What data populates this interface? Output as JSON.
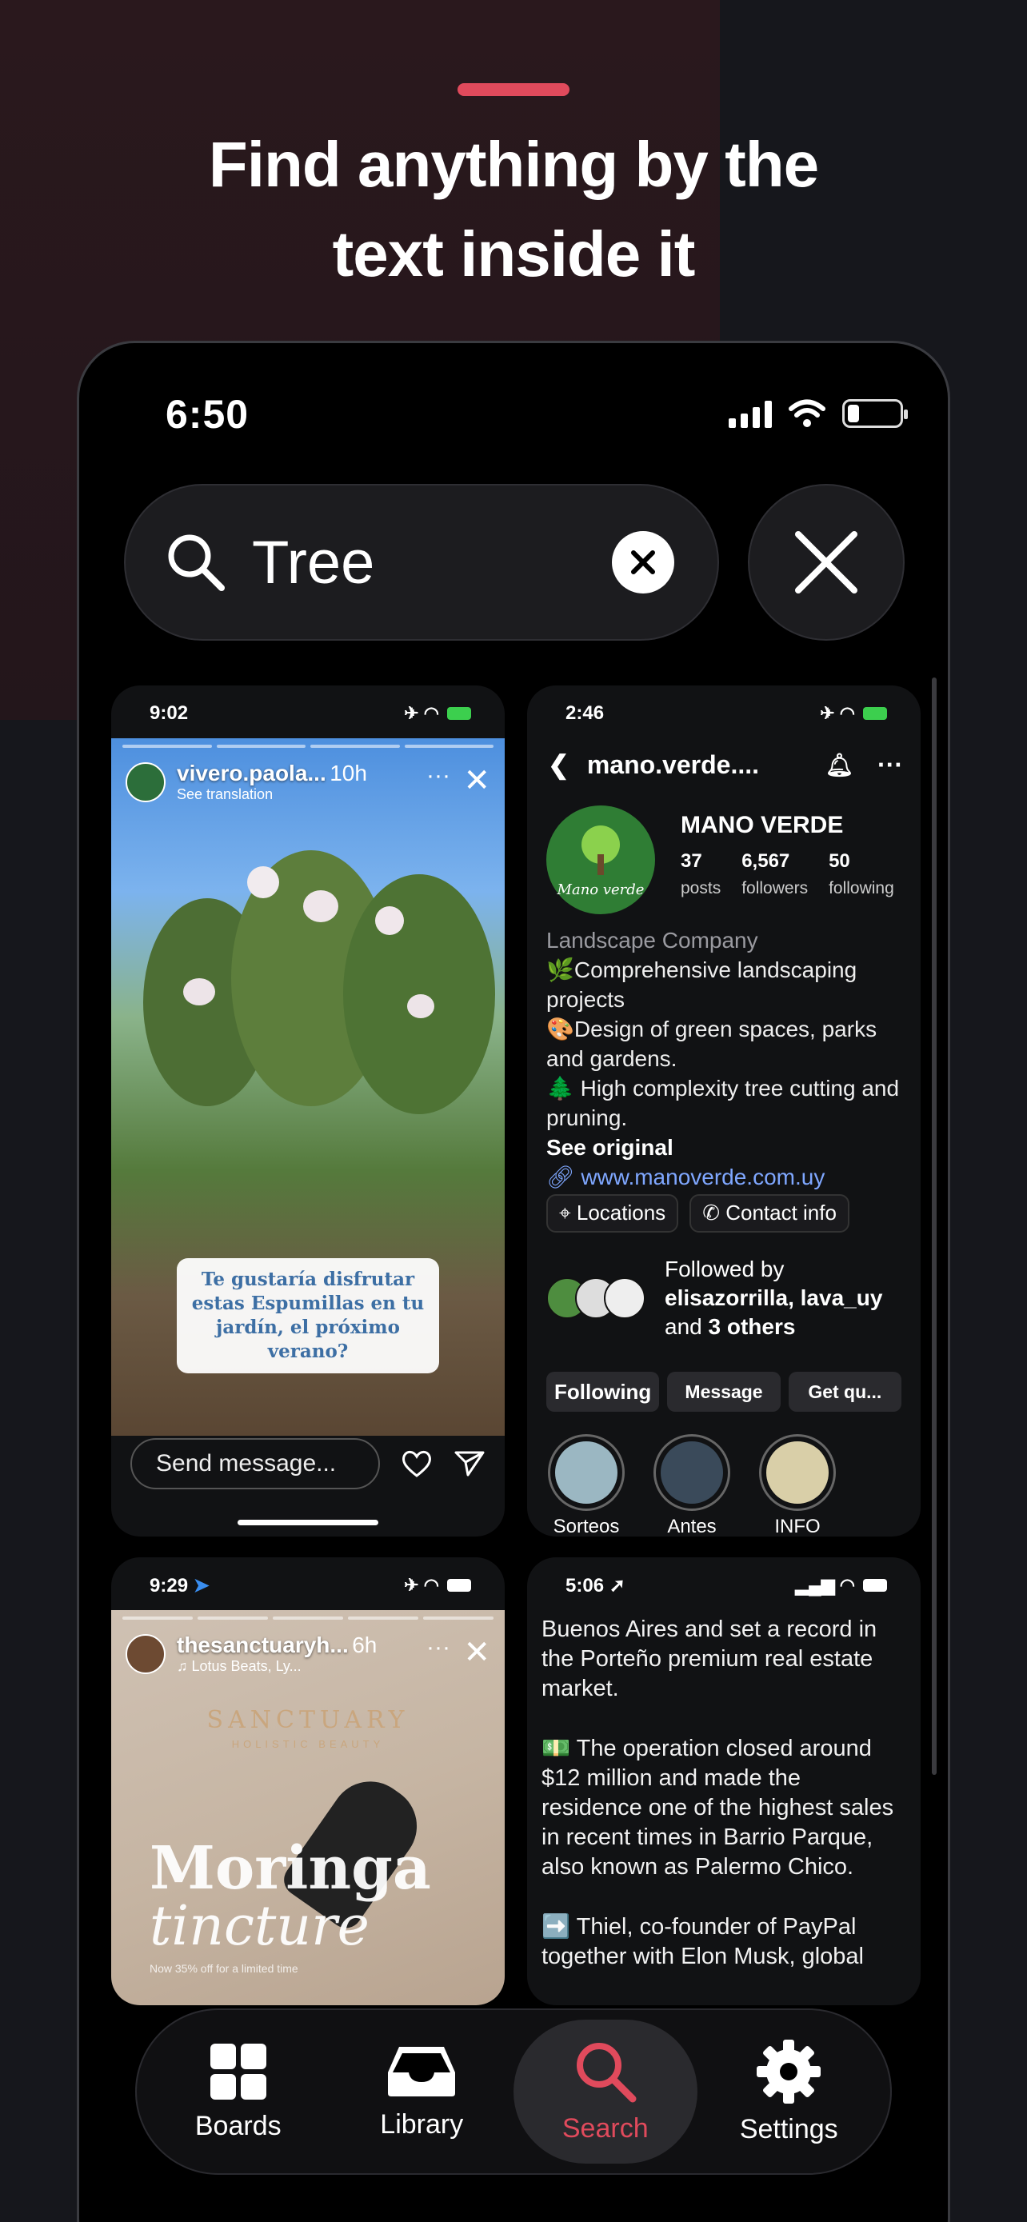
{
  "headline": {
    "line1": "Find anything by the",
    "line2": "text inside it"
  },
  "status_bar": {
    "time": "6:50"
  },
  "search": {
    "query": "Tree"
  },
  "cards": {
    "story1": {
      "time": "9:02",
      "username": "vivero.paola...",
      "subtitle": "See translation",
      "age": "10h",
      "caption": "Te gustaría disfrutar estas Espumillas en tu jardín, el próximo verano?",
      "send_placeholder": "Send message..."
    },
    "profile": {
      "time": "2:46",
      "handle": "mano.verde....",
      "brand": "MANO VERDE",
      "logo_text": "Mano verde",
      "stats": [
        {
          "num": "37",
          "label": "posts"
        },
        {
          "num": "6,567",
          "label": "followers"
        },
        {
          "num": "50",
          "label": "following"
        }
      ],
      "category": "Landscape Company",
      "bio_lines": [
        "🌿Comprehensive landscaping projects",
        "🎨Design of green spaces, parks and gardens.",
        "🌲 High complexity tree cutting and pruning."
      ],
      "see_original": "See original",
      "link": "www.manoverde.com.uy",
      "chips": [
        "Locations",
        "Contact info"
      ],
      "followed_by": "Followed by",
      "followers_names": "elisazorrilla, lava_uy",
      "and": "and",
      "others": "3 others",
      "buttons": [
        "Following",
        "Message",
        "Get qu..."
      ],
      "highlights": [
        "Sorteos",
        "Antes V...",
        "INFO"
      ]
    },
    "story2": {
      "time": "9:29",
      "username": "thesanctuaryh...",
      "subtitle": "Lotus Beats, Ly...",
      "age": "6h",
      "logo": "SANCTUARY",
      "logo_sub": "HOLISTIC BEAUTY",
      "title1": "Moringa",
      "title2": "tincture",
      "fine_print": "Now 35% off for a limited time"
    },
    "article": {
      "time": "5:06",
      "paragraphs": [
        "Buenos Aires and set a record in the Porteño premium real estate market.",
        "💵 The operation closed around $12 million and made the residence one of the highest sales in recent times in Barrio Parque, also known as Palermo Chico.",
        "➡️ Thiel, co-founder of PayPal together with Elon Musk, global"
      ]
    }
  },
  "tabbar": {
    "tabs": [
      {
        "label": "Boards",
        "icon": "grid-icon"
      },
      {
        "label": "Library",
        "icon": "inbox-icon"
      },
      {
        "label": "Search",
        "icon": "search-icon"
      },
      {
        "label": "Settings",
        "icon": "gear-icon"
      }
    ],
    "active": "Search"
  },
  "colors": {
    "accent": "#e04a5c",
    "background": "#16171c",
    "phone": "#000000"
  }
}
